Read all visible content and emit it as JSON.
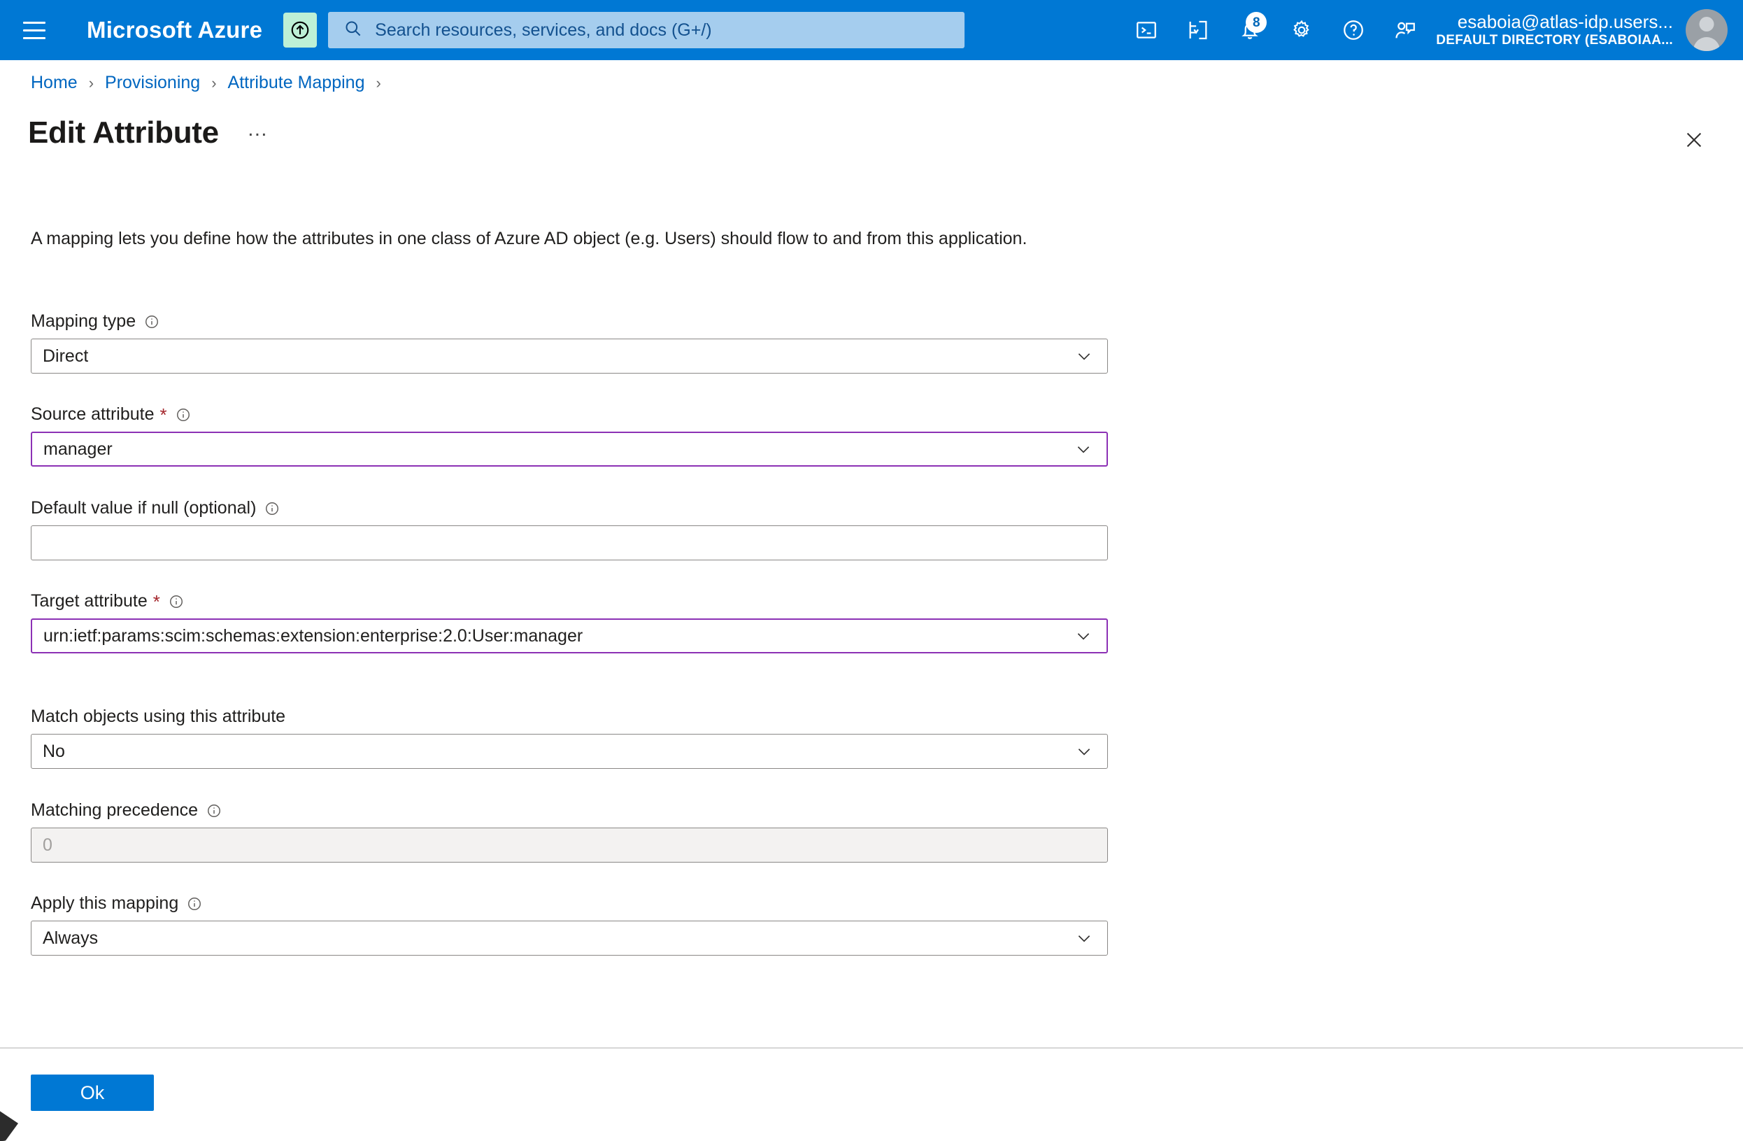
{
  "topbar": {
    "brand": "Microsoft Azure",
    "menu_icon": "hamburger-icon",
    "upload_icon": "upload-circle-icon",
    "search": {
      "placeholder": "Search resources, services, and docs (G+/)",
      "icon": "search-icon"
    },
    "icons": [
      {
        "name": "cloud-shell-icon",
        "label": "Cloud Shell"
      },
      {
        "name": "directories-subscriptions-icon",
        "label": "Directories + subscriptions"
      },
      {
        "name": "notifications-bell-icon",
        "label": "Notifications",
        "badge": "8"
      },
      {
        "name": "settings-gear-icon",
        "label": "Settings"
      },
      {
        "name": "help-question-icon",
        "label": "Help"
      },
      {
        "name": "feedback-icon",
        "label": "Feedback"
      }
    ],
    "account": {
      "email": "esaboia@atlas-idp.users...",
      "directory": "DEFAULT DIRECTORY (ESABOIAA..."
    }
  },
  "breadcrumb": {
    "items": [
      "Home",
      "Provisioning",
      "Attribute Mapping"
    ],
    "separator": "›",
    "trailing_separator": "›"
  },
  "page": {
    "title": "Edit Attribute",
    "more_actions": "…",
    "close_icon": "close-icon",
    "description": "A mapping lets you define how the attributes in one class of Azure AD object (e.g. Users) should flow to and from this application."
  },
  "form": {
    "mapping_type": {
      "label": "Mapping type",
      "value": "Direct",
      "has_info": true,
      "required": false
    },
    "source_attribute": {
      "label": "Source attribute",
      "value": "manager",
      "has_info": true,
      "required": true,
      "required_marker": "*",
      "focused": true
    },
    "default_value": {
      "label": "Default value if null (optional)",
      "value": "",
      "placeholder": "",
      "has_info": true,
      "required": false
    },
    "target_attribute": {
      "label": "Target attribute",
      "value": "urn:ietf:params:scim:schemas:extension:enterprise:2.0:User:manager",
      "has_info": true,
      "required": true,
      "required_marker": "*",
      "focused": true
    },
    "match_objects": {
      "label": "Match objects using this attribute",
      "value": "No",
      "has_info": false,
      "required": false
    },
    "matching_precedence": {
      "label": "Matching precedence",
      "value": "0",
      "has_info": true,
      "disabled": true,
      "required": false
    },
    "apply_mapping": {
      "label": "Apply this mapping",
      "value": "Always",
      "has_info": true,
      "required": false
    }
  },
  "footer": {
    "ok_label": "Ok"
  },
  "colors": {
    "azure_blue": "#0078d4",
    "link_blue": "#0066c0",
    "required_red": "#a4262c",
    "focus_purple": "#8c31b5",
    "upload_badge_green": "#bdf0d6",
    "search_bg": "#a5cdee"
  }
}
